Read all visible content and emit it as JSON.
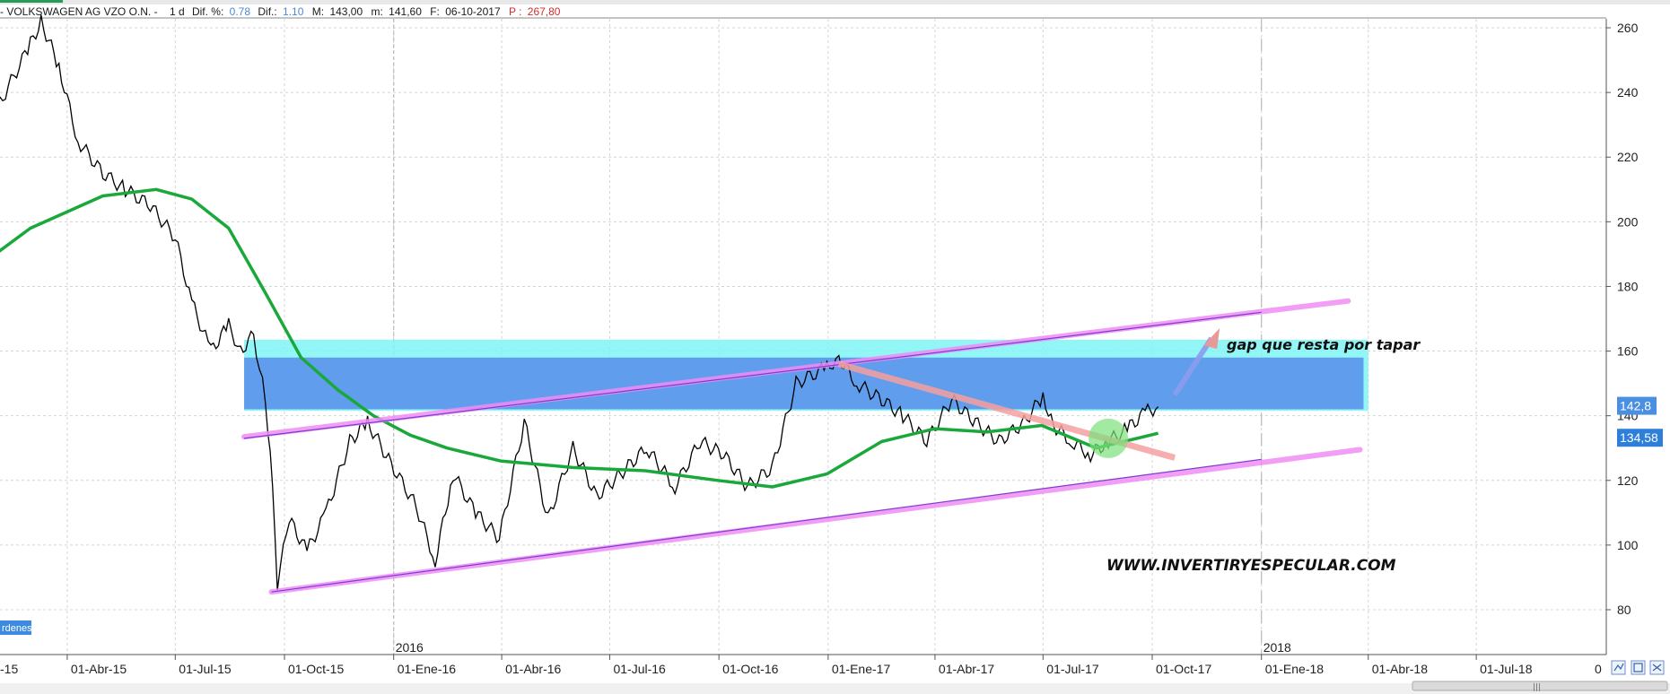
{
  "header": {
    "symbol_text": "- VOLKSWAGEN AG VZO O.N. -",
    "timeframe": "1 d",
    "dif_pct_label": "Dif. %:",
    "dif_pct_value": "0.78",
    "dif_label": "Dif.:",
    "dif_value": "1.10",
    "max_label": "M:",
    "max_value": "143,00",
    "min_label": "m:",
    "min_value": "141,60",
    "date_label": "F:",
    "date_value": "06-10-2017",
    "price_label": "P :",
    "price_value": "267,80"
  },
  "sidebar_tab": {
    "label": "rdenes"
  },
  "annotations": {
    "gap_text": "gap que resta por tapar",
    "site_text": "WWW.INVERTIRYESPECULAR.COM"
  },
  "price_tags": [
    {
      "value": "142,8",
      "price": 142.8,
      "color": "#4a90e2"
    },
    {
      "value": "134,58",
      "price": 134.58,
      "color": "#2e7fd9"
    }
  ],
  "colors": {
    "price_line": "#000000",
    "ma_line": "#1aa83a",
    "gap_zone_outer": "#7ff5f5",
    "gap_zone_inner": "#5b95ec",
    "channel_lines": "#f08cf5",
    "downtrend_line": "#f5a0a0",
    "arrow": "#8c9cf0",
    "circle_highlight": "#7be07b"
  },
  "chart_data": {
    "type": "line",
    "title": "",
    "xlabel": "",
    "ylabel": "",
    "ylim": [
      70,
      262
    ],
    "y_ticks": [
      80,
      100,
      120,
      140,
      160,
      180,
      200,
      220,
      240,
      260
    ],
    "x_ticks": [
      "01-Abr-15",
      "01-Jul-15",
      "01-Oct-15",
      "01-Ene-16",
      "01-Abr-16",
      "01-Jul-16",
      "01-Oct-16",
      "01-Ene-17",
      "01-Abr-17",
      "01-Jul-17",
      "01-Oct-17",
      "01-Ene-18",
      "01-Abr-18",
      "01-Jul-18"
    ],
    "partial_left_tick": "-15",
    "partial_right_tick": "0",
    "year_labels": [
      "2016",
      "2018"
    ],
    "series": [
      {
        "kind": "price",
        "x": [
          "2015-01-01",
          "2015-02-01",
          "2015-03-01",
          "2015-03-10",
          "2015-03-25",
          "2015-04-10",
          "2015-05-01",
          "2015-05-20",
          "2015-06-10",
          "2015-07-01",
          "2015-07-15",
          "2015-07-31",
          "2015-08-15",
          "2015-08-25",
          "2015-09-05",
          "2015-09-15",
          "2015-09-21",
          "2015-09-25",
          "2015-10-05",
          "2015-10-20",
          "2015-11-05",
          "2015-11-25",
          "2015-12-10",
          "2015-12-30",
          "2016-01-20",
          "2016-02-05",
          "2016-02-20",
          "2016-03-10",
          "2016-03-30",
          "2016-04-20",
          "2016-05-10",
          "2016-05-31",
          "2016-06-20",
          "2016-07-10",
          "2016-08-01",
          "2016-08-25",
          "2016-09-15",
          "2016-10-05",
          "2016-10-25",
          "2016-11-15",
          "2016-12-05",
          "2016-12-31",
          "2017-01-10",
          "2017-01-25",
          "2017-02-15",
          "2017-03-05",
          "2017-03-25",
          "2017-04-15",
          "2017-05-05",
          "2017-05-25",
          "2017-06-15",
          "2017-07-01",
          "2017-07-10",
          "2017-07-25",
          "2017-08-10",
          "2017-08-25",
          "2017-09-10",
          "2017-09-25",
          "2017-10-06"
        ],
        "y": [
          205,
          235,
          255,
          262,
          248,
          225,
          215,
          210,
          205,
          195,
          175,
          160,
          168,
          160,
          165,
          145,
          120,
          88,
          108,
          98,
          110,
          132,
          138,
          125,
          112,
          95,
          122,
          110,
          102,
          138,
          108,
          130,
          115,
          122,
          130,
          118,
          132,
          128,
          118,
          124,
          150,
          155,
          158,
          150,
          145,
          140,
          132,
          145,
          138,
          132,
          138,
          146,
          137,
          132,
          128,
          132,
          136,
          141,
          142.8
        ]
      },
      {
        "kind": "moving_average",
        "x": [
          "2015-01-01",
          "2015-03-01",
          "2015-05-01",
          "2015-06-15",
          "2015-07-15",
          "2015-08-15",
          "2015-09-15",
          "2015-10-15",
          "2015-11-15",
          "2015-12-15",
          "2016-01-15",
          "2016-02-15",
          "2016-03-31",
          "2016-05-31",
          "2016-07-31",
          "2016-09-30",
          "2016-11-15",
          "2016-12-31",
          "2017-02-15",
          "2017-04-01",
          "2017-05-15",
          "2017-06-30",
          "2017-08-15",
          "2017-10-06"
        ],
        "y": [
          182,
          198,
          208,
          210,
          207,
          198,
          178,
          158,
          148,
          140,
          134,
          130,
          126,
          124,
          123,
          120,
          118,
          122,
          132,
          136,
          135,
          137,
          130,
          134.58
        ]
      }
    ]
  }
}
